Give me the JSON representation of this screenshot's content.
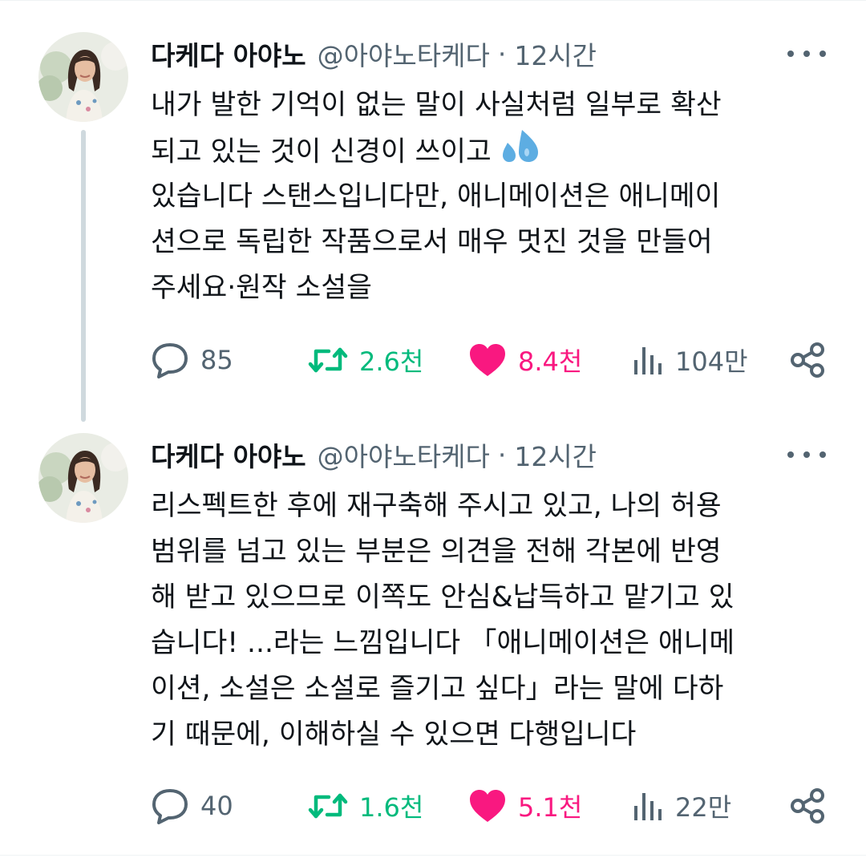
{
  "tweets": [
    {
      "author": {
        "name": "다케다 아야노",
        "handle": "@아야노타케다",
        "avatar": "profile-photo"
      },
      "time": "12시간",
      "separator": "·",
      "lines": [
        "내가 발한 기억이 없는 말이 사실처럼 일부로 확산",
        "되고 있는 것이 신경이 쓰이고",
        "있습니다 스탠스입니다만, 애니메이션은 애니메이",
        "션으로 독립한 작품으로서 매우 멋진 것을 만들어",
        "주세요·원작 소설을"
      ],
      "emoji": "sweat-droplets-emoji",
      "actions": {
        "replies": "85",
        "reposts": "2.6천",
        "likes": "8.4천",
        "views": "104만"
      }
    },
    {
      "author": {
        "name": "다케다 아야노",
        "handle": "@아야노타케다",
        "avatar": "profile-photo"
      },
      "time": "12시간",
      "separator": "·",
      "lines": [
        "리스펙트한 후에 재구축해 주시고 있고, 나의 허용",
        "범위를 넘고 있는 부분은 의견을 전해 각본에 반영",
        "해 받고 있으므로 이쪽도 안심&납득하고 맡기고 있",
        "습니다! ...라는 느낌입니다 「애니메이션은 애니메",
        "이션, 소설은 소설로 즐기고 싶다」라는 말에 다하",
        "기 때문에, 이해하실 수 있으면 다행입니다"
      ],
      "actions": {
        "replies": "40",
        "reposts": "1.6천",
        "likes": "5.1천",
        "views": "22만"
      }
    }
  ],
  "colors": {
    "text": "#0f1419",
    "secondary": "#536471",
    "repost": "#00ba7c",
    "like": "#f91880",
    "thread_line": "#cfd9de"
  },
  "icons": [
    "reply-icon",
    "repost-icon",
    "like-icon",
    "views-icon",
    "share-icon",
    "more-icon"
  ]
}
